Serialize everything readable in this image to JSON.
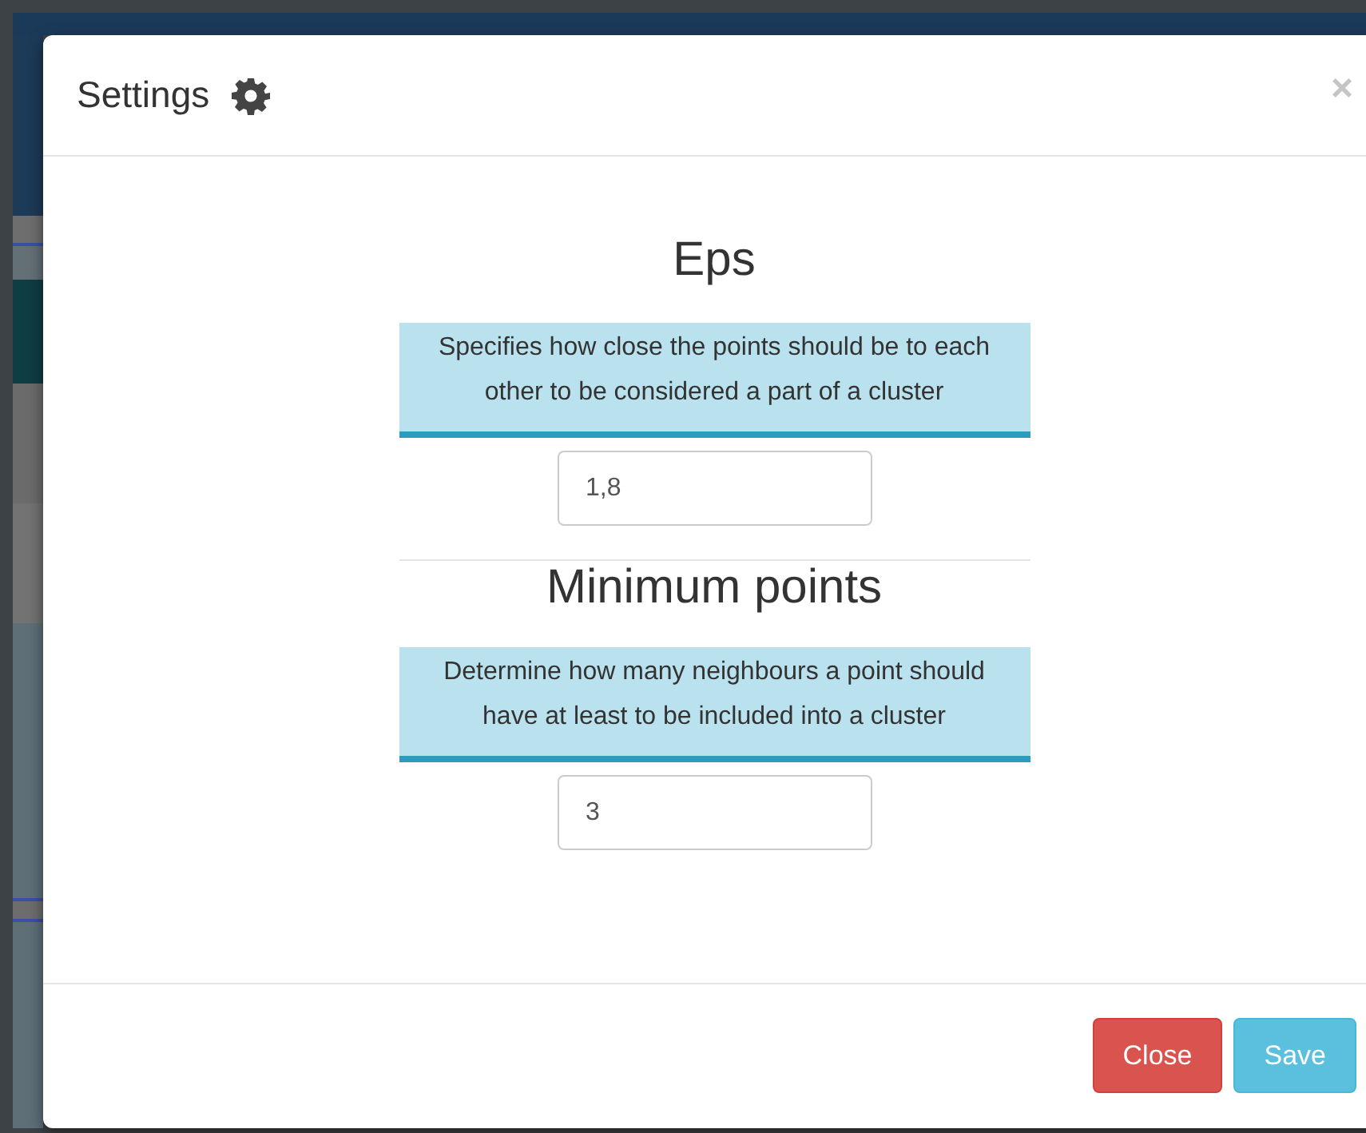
{
  "modal": {
    "title": "Settings",
    "close_symbol": "×"
  },
  "sections": [
    {
      "heading": "Eps",
      "description": "Specifies how close the points should be to each other to be considered a part of a cluster",
      "value": "1,8"
    },
    {
      "heading": "Minimum points",
      "description": "Determine how many neighbours a point should have at least to be included into a cluster",
      "value": "3"
    }
  ],
  "buttons": [
    {
      "label": "Close",
      "kind": "danger"
    },
    {
      "label": "Save",
      "kind": "info"
    }
  ]
}
